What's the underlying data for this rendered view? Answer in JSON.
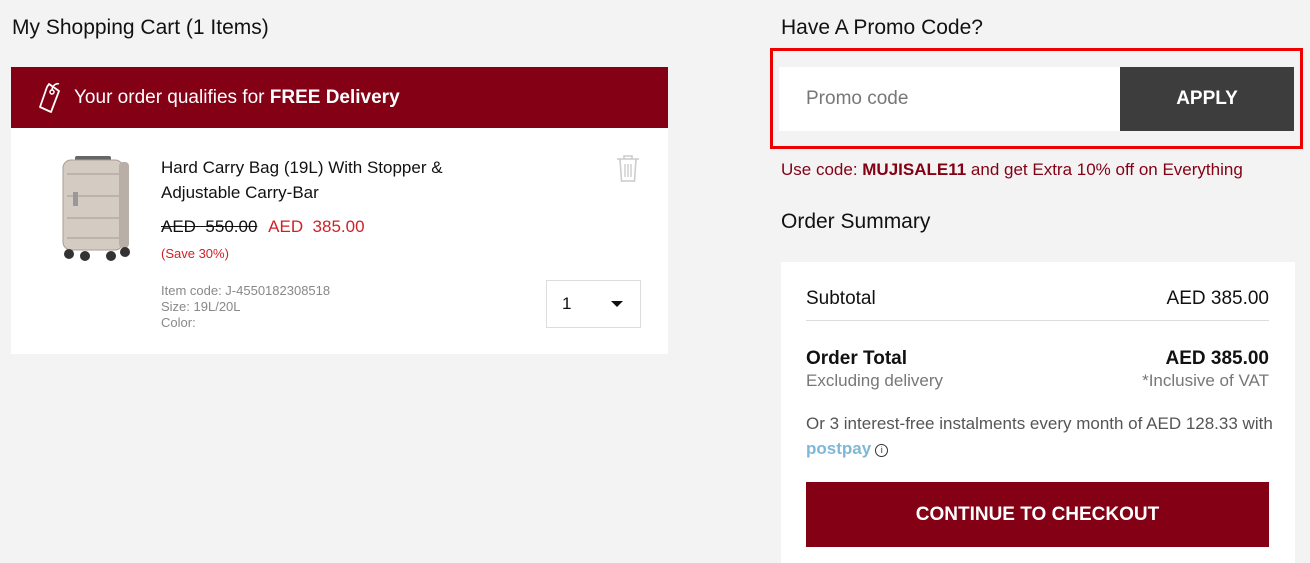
{
  "cart": {
    "title": "My Shopping Cart (1 Items)",
    "banner": {
      "prefix": "Your order qualifies for ",
      "bold": "FREE Delivery",
      "icon": "price-tag-icon"
    },
    "item": {
      "name": "Hard Carry Bag (19L) With Stopper & Adjustable Carry-Bar",
      "old_currency": "AED",
      "old_price": "550.00",
      "new_price": "AED  385.00",
      "save": "(Save 30%)",
      "item_code": "Item code: J-4550182308518",
      "size": "Size: 19L/20L",
      "color": "Color:",
      "quantity": "1",
      "delete_icon": "trash-icon"
    }
  },
  "promo": {
    "title": "Have A Promo Code?",
    "placeholder": "Promo code",
    "apply_label": "APPLY",
    "hint_prefix": "Use code: ",
    "hint_code": "MUJISALE11",
    "hint_suffix": " and get Extra 10% off on Everything"
  },
  "summary": {
    "title": "Order Summary",
    "subtotal_label": "Subtotal",
    "subtotal_value": "AED 385.00",
    "total_label": "Order Total",
    "total_value": "AED 385.00",
    "excluding": "Excluding delivery",
    "inclusive": "*Inclusive of VAT",
    "installments_text": "Or 3 interest-free instalments every month of AED 128.33 with ",
    "postpay": "postpay",
    "info_glyph": "i",
    "checkout_label": "CONTINUE TO CHECKOUT"
  },
  "colors": {
    "brand": "#830015",
    "sale": "#d11f26",
    "apply_bg": "#3d3d3d",
    "highlight": "#ee0000"
  }
}
